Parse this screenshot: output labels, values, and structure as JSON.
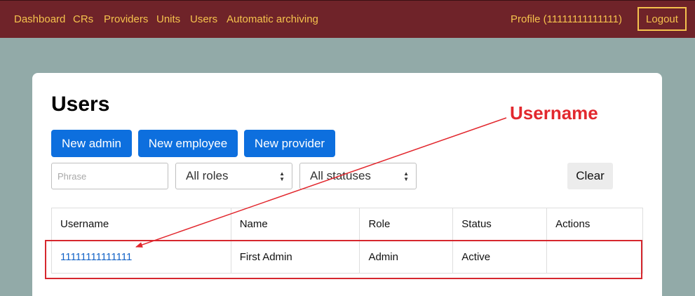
{
  "nav": {
    "links": [
      "Dashboard",
      "CRs",
      "Providers",
      "Units",
      "Users",
      "Automatic archiving"
    ],
    "profile": "Profile (11111111111111)",
    "logout": "Logout"
  },
  "page": {
    "title": "Users",
    "buttons": {
      "new_admin": "New admin",
      "new_employee": "New employee",
      "new_provider": "New provider"
    },
    "filters": {
      "phrase_placeholder": "Phrase",
      "role_selected": "All roles",
      "status_selected": "All statuses",
      "clear": "Clear"
    },
    "table": {
      "headers": [
        "Username",
        "Name",
        "Role",
        "Status",
        "Actions"
      ],
      "rows": [
        {
          "username": "11111111111111",
          "name": "First Admin",
          "role": "Admin",
          "status": "Active",
          "actions": ""
        }
      ]
    }
  },
  "annotation": {
    "label": "Username",
    "color": "#e2282e"
  },
  "colors": {
    "navbar": "#6f2329",
    "nav_link": "#f5c24d",
    "background": "#92aaa8",
    "primary_button": "#0d6fde",
    "link": "#1464c8"
  }
}
